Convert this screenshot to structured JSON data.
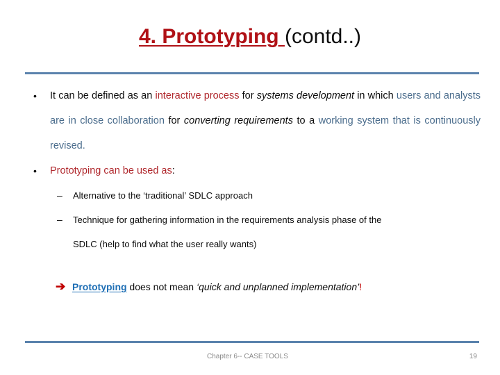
{
  "slide": {
    "title": {
      "highlight": "4. Prototyping ",
      "rest": "(contd..)",
      "highlight_color": "#B01116",
      "rest_color": "#0d0d0d"
    },
    "divider_color": "#5B83AD",
    "bullets": [
      {
        "marker": "•",
        "runs": [
          {
            "text": "It can be defined as an ",
            "style": "black"
          },
          {
            "text": "interactive process",
            "style": "red"
          },
          {
            "text": " for ",
            "style": "black"
          },
          {
            "text": "systems development",
            "style": "black-italic"
          },
          {
            "text": " in which ",
            "style": "black"
          },
          {
            "text": "users and analysts are in close collaboration",
            "style": "blue"
          },
          {
            "text": " for ",
            "style": "black"
          },
          {
            "text": "converting requirements",
            "style": "black-italic"
          },
          {
            "text": " to a ",
            "style": "black"
          },
          {
            "text": "working system that is continuously revised.",
            "style": "blue"
          }
        ]
      },
      {
        "marker": "•",
        "runs": [
          {
            "text": "Prototyping can be used as",
            "style": "red"
          },
          {
            "text": ":",
            "style": "black"
          }
        ]
      }
    ],
    "sub_bullets": [
      {
        "marker": "–",
        "text": "Alternative to the ‘traditional’ SDLC approach"
      },
      {
        "marker": "–",
        "text": "Technique for gathering information in the requirements analysis phase of the",
        "continuation": "SDLC (help to find what the user really wants)"
      }
    ],
    "callout": {
      "arrow_glyph": "➔",
      "arrow_color": "#C00000",
      "runs": [
        {
          "text": "Prototyping",
          "style": "linkblue"
        },
        {
          "text": " does not mean ",
          "style": "black"
        },
        {
          "text": "‘quick and unplanned implementation’",
          "style": "black-italic"
        },
        {
          "text": "!",
          "style": "redb"
        }
      ]
    },
    "footer": {
      "left": "Chapter 6-- CASE TOOLS",
      "right": "19",
      "color": "#8a8a8a"
    }
  }
}
